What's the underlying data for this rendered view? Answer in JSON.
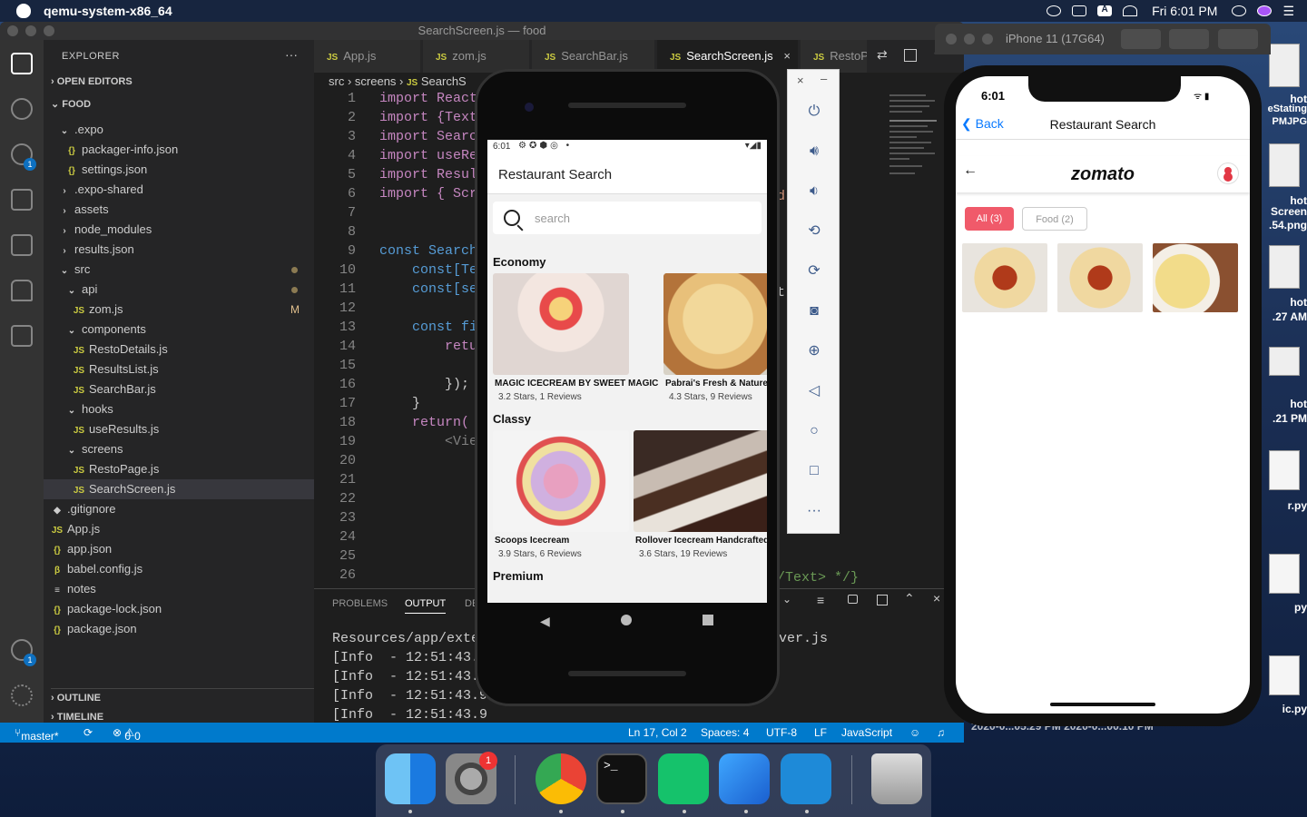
{
  "menubar": {
    "app_name": "qemu-system-x86_64",
    "clock": "Fri 6:01 PM",
    "input_indicator": "A"
  },
  "vscode": {
    "window_title": "SearchScreen.js — food",
    "sidebar": {
      "title": "EXPLORER",
      "more": "···",
      "open_editors": "OPEN EDITORS",
      "root": "FOOD",
      "items": [
        {
          "label": ".expo",
          "icon": "chevron-down"
        },
        {
          "label": "packager-info.json",
          "icon": "json"
        },
        {
          "label": "settings.json",
          "icon": "json"
        },
        {
          "label": ".expo-shared",
          "icon": "chevron-right"
        },
        {
          "label": "assets",
          "icon": "chevron-right"
        },
        {
          "label": "node_modules",
          "icon": "chevron-right"
        },
        {
          "label": "results.json",
          "icon": "chevron-right"
        },
        {
          "label": "src",
          "icon": "chevron-down"
        },
        {
          "label": "api",
          "icon": "chevron-down"
        },
        {
          "label": "zom.js",
          "icon": "js",
          "status": "M"
        },
        {
          "label": "components",
          "icon": "chevron-down"
        },
        {
          "label": "RestoDetails.js",
          "icon": "js"
        },
        {
          "label": "ResultsList.js",
          "icon": "js"
        },
        {
          "label": "SearchBar.js",
          "icon": "js"
        },
        {
          "label": "hooks",
          "icon": "chevron-down"
        },
        {
          "label": "useResults.js",
          "icon": "js"
        },
        {
          "label": "screens",
          "icon": "chevron-down"
        },
        {
          "label": "RestoPage.js",
          "icon": "js"
        },
        {
          "label": "SearchScreen.js",
          "icon": "js"
        },
        {
          "label": ".gitignore",
          "icon": "git"
        },
        {
          "label": "App.js",
          "icon": "js"
        },
        {
          "label": "app.json",
          "icon": "json"
        },
        {
          "label": "babel.config.js",
          "icon": "babel"
        },
        {
          "label": "notes",
          "icon": "text"
        },
        {
          "label": "package-lock.json",
          "icon": "json"
        },
        {
          "label": "package.json",
          "icon": "json"
        }
      ],
      "outline": "OUTLINE",
      "timeline": "TIMELINE"
    },
    "tabs": [
      "App.js",
      "zom.js",
      "SearchBar.js",
      "SearchScreen.js",
      "RestoP"
    ],
    "active_tab": "SearchScreen.js",
    "breadcrumb": [
      "src",
      "screens",
      "SearchS"
    ],
    "code_lines": [
      "import React",
      "import {Text",
      "import Search",
      "import useRes",
      "import Result",
      "import { Scro",
      "",
      "",
      "const SearchS",
      "    const[Ter",
      "    const[sea",
      "",
      "    const fil",
      "        retur",
      "            ",
      "        });",
      "    }",
      "    return(",
      "        <View",
      "            <",
      "            T",
      "            d",
      "            d",
      "            <",
      "            <",
      "            <"
    ],
    "code_right_fragments": {
      "line6": "d",
      "line11": "t",
      "line26": "/Text> */}"
    },
    "panel": {
      "tabs": [
        "PROBLEMS",
        "OUTPUT",
        "DE"
      ],
      "active": "OUTPUT",
      "lines": [
        "Resources/app/exter",
        "[Info  - 12:51:43.8",
        "[Info  - 12:51:43.9",
        "[Info  - 12:51:43.9",
        "[Info  - 12:51:43.9"
      ],
      "right_fragment": "ver.js"
    },
    "statusbar": {
      "branch": "master*",
      "errors": "0",
      "warnings": "0",
      "position": "Ln 17, Col 2",
      "spaces": "Spaces: 4",
      "encoding": "UTF-8",
      "eol": "LF",
      "language": "JavaScript"
    },
    "badges": {
      "scm": "1",
      "accounts": "1"
    }
  },
  "android": {
    "status_time": "6:01",
    "title": "Restaurant Search",
    "search_placeholder": "search",
    "sections": [
      {
        "name": "Economy",
        "items": [
          {
            "name": "MAGIC ICECREAM BY SWEET MAGIC",
            "info": "3.2 Stars, 1 Reviews"
          },
          {
            "name": "Pabrai's Fresh & Naturel",
            "info": "4.3 Stars, 9 Reviews"
          }
        ]
      },
      {
        "name": "Classy",
        "items": [
          {
            "name": "Scoops Icecream",
            "info": "3.9 Stars, 6 Reviews"
          },
          {
            "name": "Rollover Icecream Handcrafted",
            "info": "3.6 Stars, 19 Reviews"
          }
        ]
      },
      {
        "name": "Premium",
        "items": []
      }
    ]
  },
  "ios": {
    "device": "iPhone 11 (17G64)",
    "time": "6:01",
    "back": "Back",
    "title": "Restaurant Search",
    "logo": "zomato",
    "chips": [
      "All (3)",
      "Food (2)"
    ]
  },
  "desktop_labels": [
    "hot",
    "eStating",
    "PMJPG",
    "hot",
    "Screen",
    ".54.png",
    "hot",
    ".27 AM",
    "hot",
    ".21 PM",
    "r.py",
    "py",
    "ic.py"
  ],
  "desktop_bottom_text": "2020-0...05.29 PM 2020-0...00.10 PM",
  "dock": {
    "system_prefs_badge": "1"
  },
  "colors": {
    "vscode_bg": "#1e1e1e",
    "statusbar": "#007acc",
    "zomato_red": "#e23744",
    "ios_link": "#0a7aff"
  }
}
